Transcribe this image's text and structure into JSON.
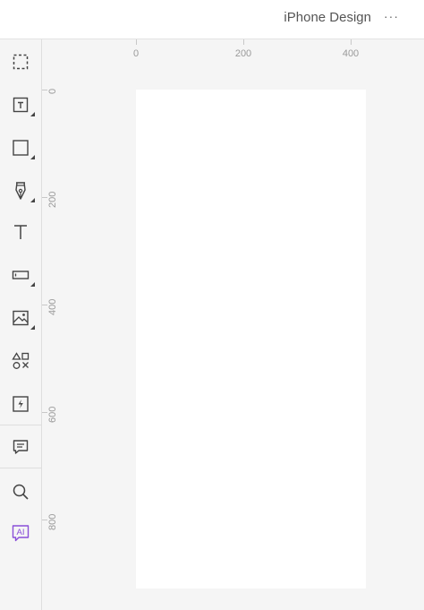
{
  "header": {
    "title": "iPhone Design",
    "more_label": "···"
  },
  "toolbar": {
    "tools": [
      {
        "name": "select",
        "icon": "marquee-select-icon"
      },
      {
        "name": "text-box",
        "icon": "text-box-icon"
      },
      {
        "name": "rectangle",
        "icon": "rectangle-icon"
      },
      {
        "name": "pen",
        "icon": "pen-icon"
      },
      {
        "name": "text",
        "icon": "text-icon"
      },
      {
        "name": "input-field",
        "icon": "input-field-icon"
      },
      {
        "name": "image",
        "icon": "image-icon"
      },
      {
        "name": "components",
        "icon": "components-icon"
      },
      {
        "name": "interaction",
        "icon": "lightning-icon"
      },
      {
        "name": "comment",
        "icon": "comment-icon"
      },
      {
        "name": "search",
        "icon": "search-icon"
      },
      {
        "name": "ai",
        "icon": "ai-icon",
        "label": "AI"
      }
    ],
    "accent_color": "#8a4fd8"
  },
  "rulers": {
    "horizontal_labels": [
      "0",
      "200",
      "400"
    ],
    "vertical_labels": [
      "0",
      "200",
      "400",
      "600",
      "800"
    ]
  }
}
